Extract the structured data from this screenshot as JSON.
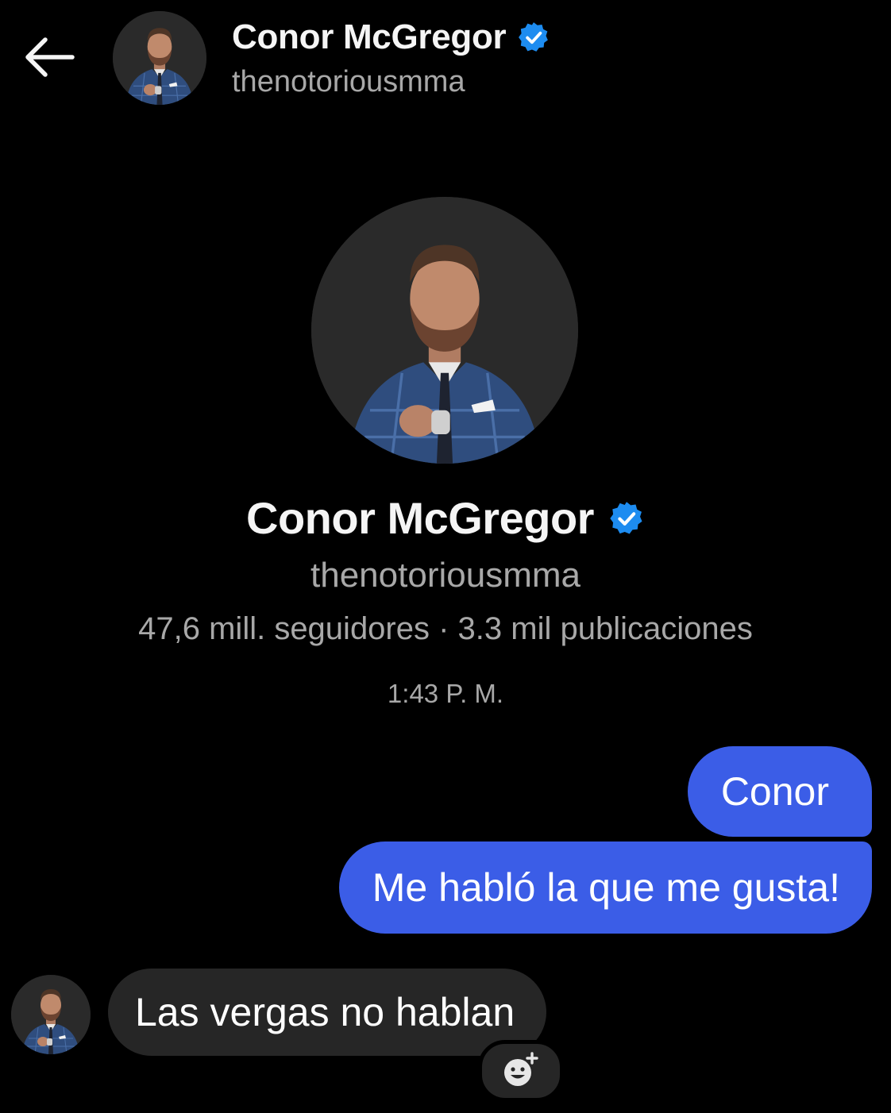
{
  "header": {
    "back_icon": "arrow-left-icon",
    "name": "Conor McGregor",
    "username": "thenotoriousmma",
    "verified_icon": "verified-badge-icon",
    "verified_color": "#1d8cf0"
  },
  "profile": {
    "name": "Conor McGregor",
    "username": "thenotoriousmma",
    "stats": "47,6 mill. seguidores · 3.3 mil publicaciones"
  },
  "conversation": {
    "timestamp": "1:43 P. M.",
    "messages": [
      {
        "direction": "outgoing",
        "text": "Conor"
      },
      {
        "direction": "outgoing",
        "text": "Me habló la que me gusta!"
      },
      {
        "direction": "incoming",
        "text": "Las vergas no hablan"
      }
    ],
    "reaction_icon": "add-reaction-icon"
  },
  "colors": {
    "background": "#000000",
    "outgoing_bubble": "#3b5de7",
    "incoming_bubble": "#262626",
    "secondary_text": "#a8a8a8"
  }
}
